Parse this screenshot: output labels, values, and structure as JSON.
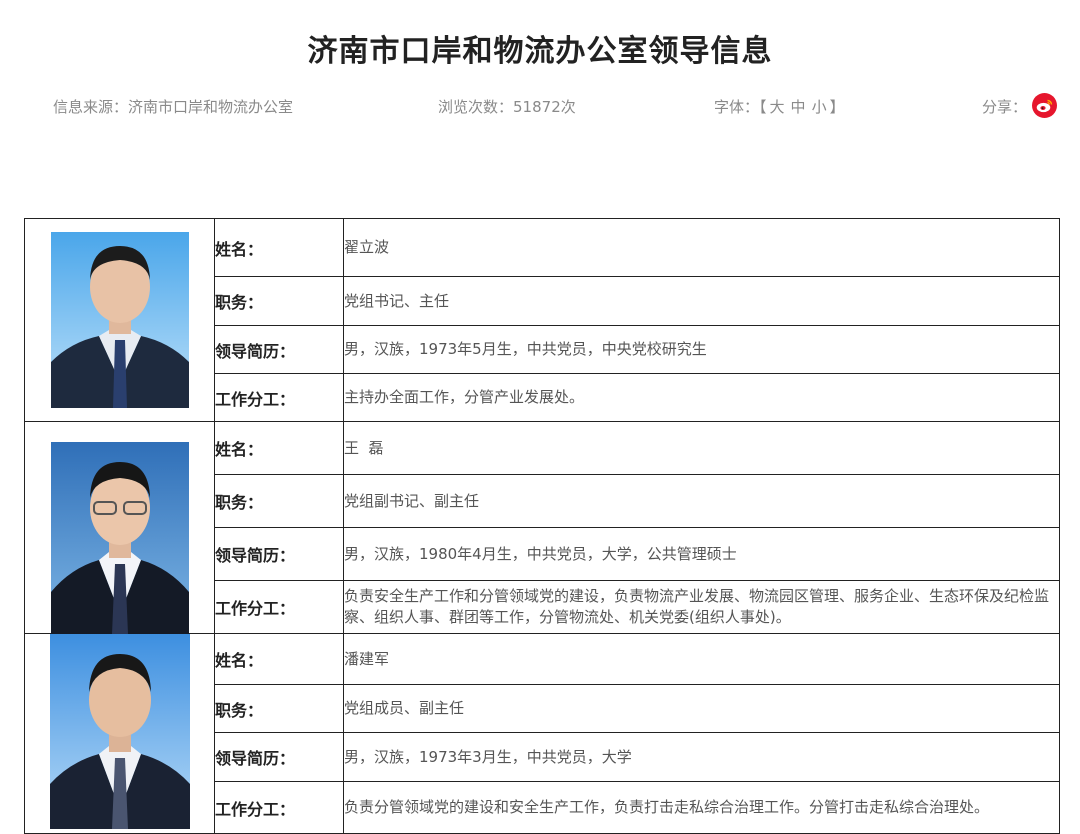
{
  "page": {
    "title": "济南市口岸和物流办公室领导信息",
    "source_label": "信息来源：",
    "source_value": "济南市口岸和物流办公室",
    "views_label": "浏览次数：",
    "views_value": "51872次",
    "font_label": "字体：",
    "font_open": "【",
    "font_large": "大",
    "font_medium": "中",
    "font_small": "小",
    "font_close": "】",
    "share_label": "分享：",
    "share_icon": "weibo-icon"
  },
  "labels": {
    "name": "姓名：",
    "position": "职务：",
    "resume": "领导简历：",
    "duty": "工作分工："
  },
  "leaders": [
    {
      "name": "翟立波",
      "position": "党组书记、主任",
      "resume": "男，汉族，1973年5月生，中共党员，中央党校研究生",
      "duty": "主持办全面工作，分管产业发展处。"
    },
    {
      "name": "王  磊",
      "position": "党组副书记、副主任",
      "resume": "男，汉族，1980年4月生，中共党员，大学，公共管理硕士",
      "duty": "负责安全生产工作和分管领域党的建设，负责物流产业发展、物流园区管理、服务企业、生态环保及纪检监察、组织人事、群团等工作，分管物流处、机关党委(组织人事处)。"
    },
    {
      "name": "潘建军",
      "position": "党组成员、副主任",
      "resume": "男，汉族，1973年3月生，中共党员，大学",
      "duty": "负责分管领域党的建设和安全生产工作，负责打击走私综合治理工作。分管打击走私综合治理处。"
    }
  ],
  "colors": {
    "weibo_red": "#e6162d",
    "photo_bg_light": "#8ec8f2",
    "photo_bg_dark": "#2d6fc4"
  }
}
